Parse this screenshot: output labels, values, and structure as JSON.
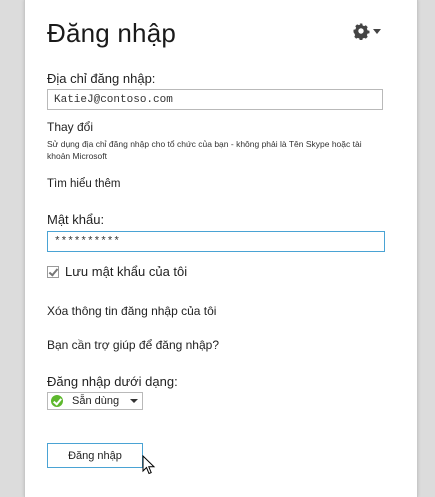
{
  "header": {
    "title": "Đăng nhập"
  },
  "login": {
    "address_label": "Địa chỉ đăng nhập:",
    "address_value": "KatieJ@contoso.com",
    "change_link": "Thay đổi",
    "hint": "Sử dụng địa chỉ đăng nhập cho tổ chức của bạn - không phải là Tên Skype hoặc tài khoản Microsoft",
    "learn_more": "Tìm hiểu thêm",
    "password_label": "Mật khẩu:",
    "password_value": "**********",
    "remember_label": "Lưu mật khẩu của tôi",
    "remember_checked": true,
    "delete_info": "Xóa thông tin đăng nhập của tôi",
    "help": "Bạn cần trợ giúp để đăng nhập?",
    "signin_as_label": "Đăng nhập dưới dạng:",
    "status_selected": "Sẵn dùng",
    "signin_button": "Đăng nhập"
  },
  "icons": {
    "settings": "gear-icon",
    "status": "available-check-icon",
    "cursor": "mouse-pointer-icon"
  },
  "colors": {
    "accent_border": "#4aa3d4",
    "available_green": "#5db82d"
  }
}
